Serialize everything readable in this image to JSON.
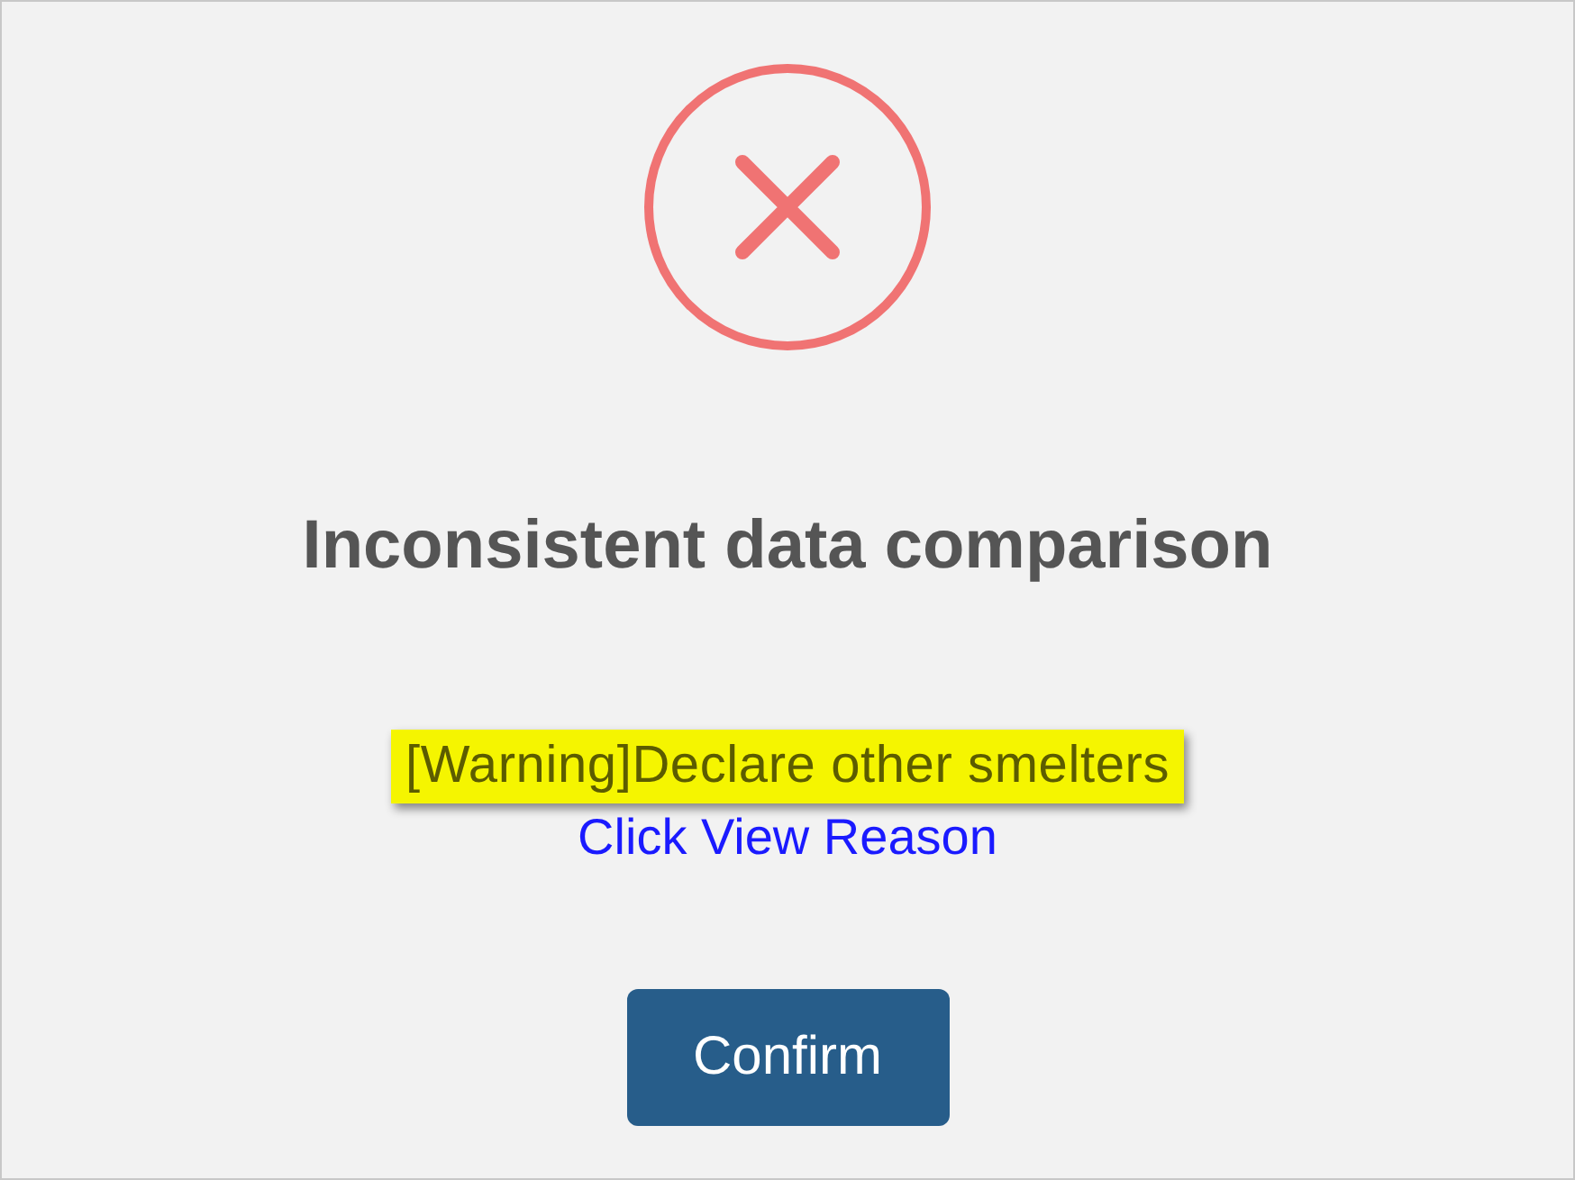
{
  "dialog": {
    "status_icon": {
      "kind": "error"
    },
    "title": "Inconsistent data comparison",
    "warning": "[Warning]Declare other smelters",
    "link": "Click View Reason",
    "buttons": [
      "Confirm"
    ]
  }
}
